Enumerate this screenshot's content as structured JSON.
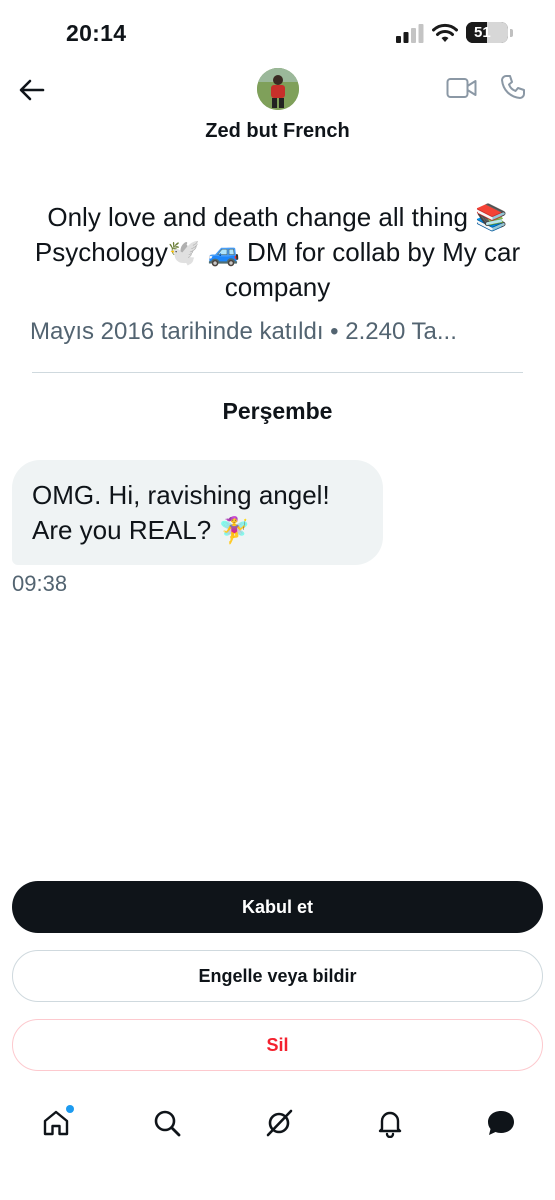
{
  "status_bar": {
    "time": "20:14",
    "battery": "51",
    "battery_level": 0.51,
    "icons": [
      "cellular-signal-icon",
      "wifi-icon",
      "battery-icon"
    ]
  },
  "header": {
    "contact_name": "Zed but French",
    "icons": [
      "back-arrow-icon",
      "avatar",
      "video-call-icon",
      "phone-icon"
    ]
  },
  "profile": {
    "bio_line1": "Only love and death change all thing 📚",
    "bio_line2": "Psychology🕊️ 🚙 DM for collab by My car",
    "bio_line3": "company",
    "joined": "Mayıs 2016 tarihinde katıldı • 2.240 Ta..."
  },
  "conversation": {
    "day_label": "Perşembe",
    "messages": [
      {
        "line1": "OMG. Hi, ravishing angel!",
        "line2": "Are you REAL? 🧚‍♀️",
        "time": "09:38"
      }
    ]
  },
  "actions": {
    "accept_label": "Kabul et",
    "block_label": "Engelle veya bildir",
    "delete_label": "Sil"
  },
  "tab_bar": {
    "tabs": [
      "home-icon",
      "search-icon",
      "grok-icon",
      "notifications-bell-icon",
      "messages-icon"
    ]
  },
  "colors": {
    "accent_blue": "#1d9bf0",
    "text_primary": "#0f1419",
    "text_secondary": "#536471",
    "bubble_bg": "#eff3f4",
    "danger": "#f4212e",
    "border": "#cfd9de"
  }
}
